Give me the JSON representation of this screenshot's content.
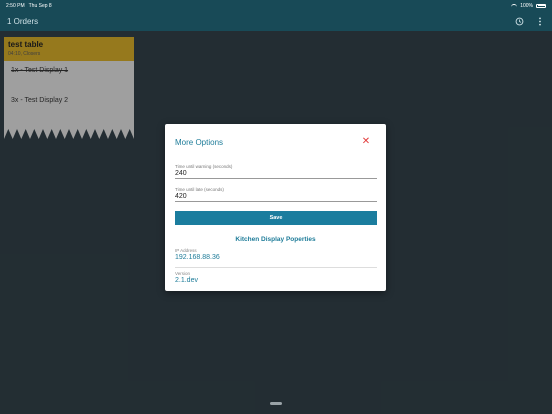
{
  "status_bar": {
    "time": "2:50 PM",
    "date": "Thu Sep 8",
    "battery": "100%"
  },
  "app_bar": {
    "title": "1 Orders",
    "history_icon": "clock-history-icon",
    "menu_icon": "more-vert-icon"
  },
  "ticket": {
    "title": "test table",
    "subtitle": "04:10, Closers",
    "items": [
      {
        "text": "1x - Test Display 1",
        "done": true
      },
      {
        "text": "3x - Test Display 2",
        "done": false
      }
    ]
  },
  "dialog": {
    "title": "More Options",
    "fields": [
      {
        "label": "Time until warning (seconds)",
        "value": "240"
      },
      {
        "label": "Time until late (seconds)",
        "value": "420"
      }
    ],
    "save_label": "Save",
    "section_heading": "Kitchen Display Poperties",
    "properties": [
      {
        "label": "IP Address",
        "value": "192.168.88.36"
      },
      {
        "label": "Version",
        "value": "2.1.dev"
      }
    ]
  },
  "colors": {
    "app_bar": "#184a57",
    "background": "#2f3d44",
    "accent": "#1b7d9e",
    "ticket_header": "#c9a227",
    "close": "#e23b3b"
  }
}
